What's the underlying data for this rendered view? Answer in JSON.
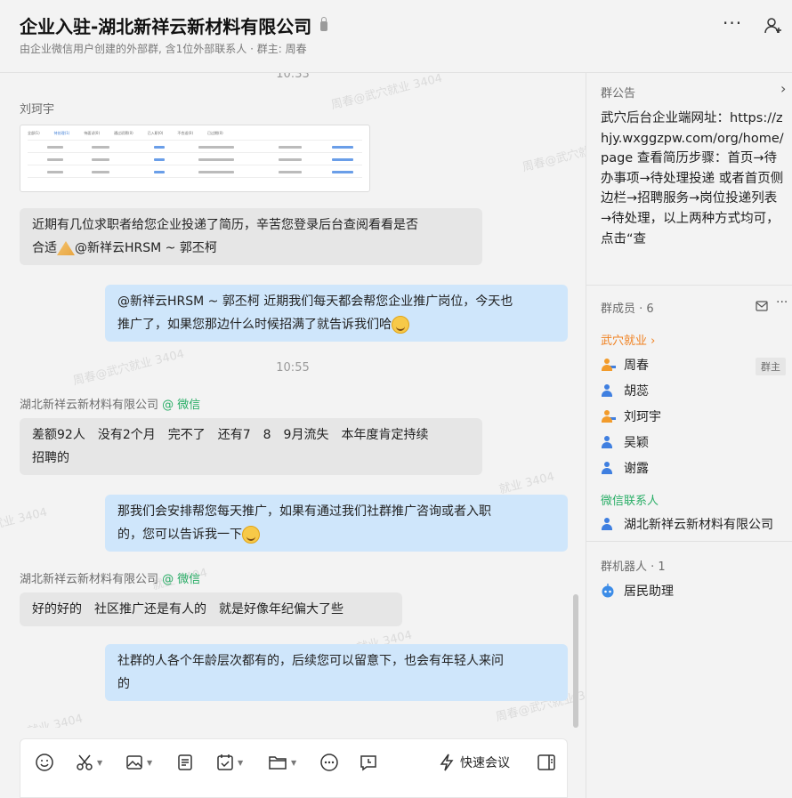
{
  "header": {
    "title": "企业入驻-湖北新祥云新材料有限公司",
    "subtitle": "由企业微信用户创建的外部群, 含1位外部联系人 · 群主: 周春",
    "more_label": "···"
  },
  "chat": {
    "watermark": "周春@武穴就业 3404",
    "watermark_short": "就业 3404",
    "messages": {
      "time1": "10:33",
      "sender1": "刘珂宇",
      "screenshot_tabs": [
        "全部(1)",
        "待处理(1)",
        "待面试(0)",
        "通过初筛(0)",
        "已入职(0)",
        "不合适(0)",
        "已过期(0)"
      ],
      "msg1": "近期有几位求职者给您企业投递了简历，辛苦您登录后台查阅看看是否",
      "msg1b": "合适",
      "msg1c": "@新祥云HRSM ~ 郭丕柯",
      "msg2": "@新祥云HRSM ~ 郭丕柯 近期我们每天都会帮您企业推广岗位，今天也",
      "msg2b": "推广了，如果您那边什么时候招满了就告诉我们哈",
      "time2": "10:55",
      "sender2": "湖北新祥云新材料有限公司",
      "sender2_tag": "@ 微信",
      "msg3": "差额92人　没有2个月　完不了　还有7　8　9月流失　本年度肯定持续",
      "msg3b": "招聘的",
      "msg4": "那我们会安排帮您每天推广，如果有通过我们社群推广咨询或者入职",
      "msg4b": "的，您可以告诉我一下",
      "sender3": "湖北新祥云新材料有限公司",
      "sender3_tag": "@ 微信",
      "msg5": "好的好的　社区推广还是有人的　就是好像年纪偏大了些",
      "msg6": "社群的人各个年龄层次都有的，后续您可以留意下，也会有年轻人来问",
      "msg6b": "的"
    }
  },
  "toolbar": {
    "quick_meeting": "快速会议"
  },
  "sidebar": {
    "notice_title": "群公告",
    "notice_text": "武穴后台企业端网址：https://zhjy.wxggzpw.com/org/home/page 查看简历步骤：首页→待办事项→待处理投递 或者首页侧边栏→招聘服务→岗位投递列表→待处理，以上两种方式均可，点击“查",
    "members_title": "群成员 · 6",
    "group_label": "武穴就业 ›",
    "members": [
      "周春",
      "胡蕊",
      "刘珂宇",
      "吴颖",
      "谢露"
    ],
    "owner_badge": "群主",
    "wechat_contacts_label": "微信联系人",
    "wechat_contact": "湖北新祥云新材料有限公司",
    "robots_title": "群机器人 · 1",
    "robot": "居民助理"
  }
}
